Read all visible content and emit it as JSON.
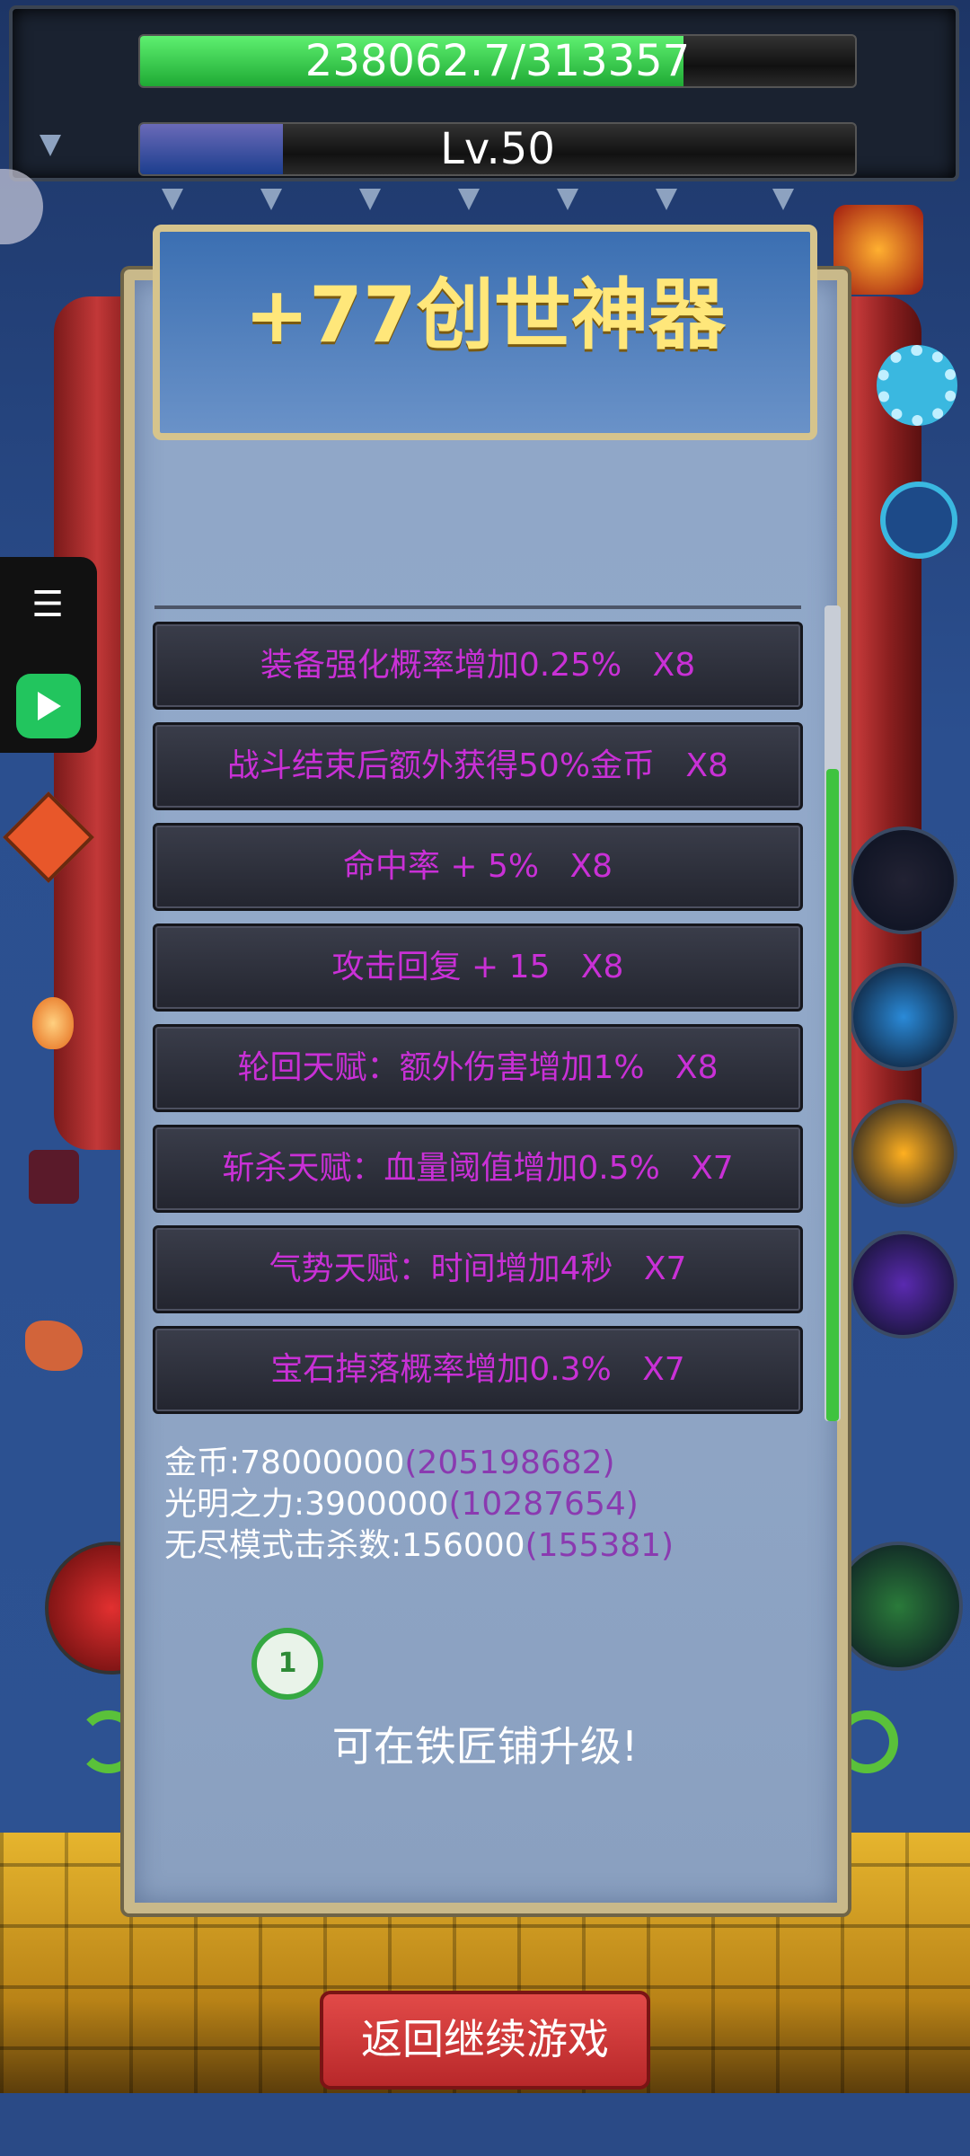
{
  "hud": {
    "hp_text": "238062.7/313357",
    "hp_fraction": 0.76,
    "level_text": "Lv.50",
    "exp_fraction": 0.2,
    "hp_color": "#2fd44a",
    "exp_color": "#3b5fb0"
  },
  "title": "+77创世神器",
  "attributes": [
    "装备强化概率增加0.25%   X8",
    "战斗结束后额外获得50%金币   X8",
    "命中率 + 5%   X8",
    "攻击回复 + 15   X8",
    "轮回天赋：额外伤害增加1%   X8",
    "斩杀天赋：血量阈值增加0.5%   X7",
    "气势天赋：时间增加4秒   X7",
    "宝石掉落概率增加0.3%   X7"
  ],
  "stats": [
    {
      "label": "金币:78000000",
      "sub": "(205198682)"
    },
    {
      "label": "光明之力:3900000",
      "sub": "(10287654)"
    },
    {
      "label": "无尽模式击杀数:156000",
      "sub": "(155381)"
    }
  ],
  "badge_number": "1",
  "hint": "可在铁匠铺升级!",
  "return_button": "返回继续游戏",
  "side_icons": [
    "settings-gear-icon",
    "skill-icon",
    "demon-boss-icon",
    "alert-icon",
    "fire-gem-icon",
    "dragon-icon",
    "refresh-icon"
  ],
  "colors": {
    "attribute_text": "#c930d6",
    "title": "#ffe77a",
    "stat_sub": "#8a3ab0",
    "scroll": "#3fc33f"
  }
}
